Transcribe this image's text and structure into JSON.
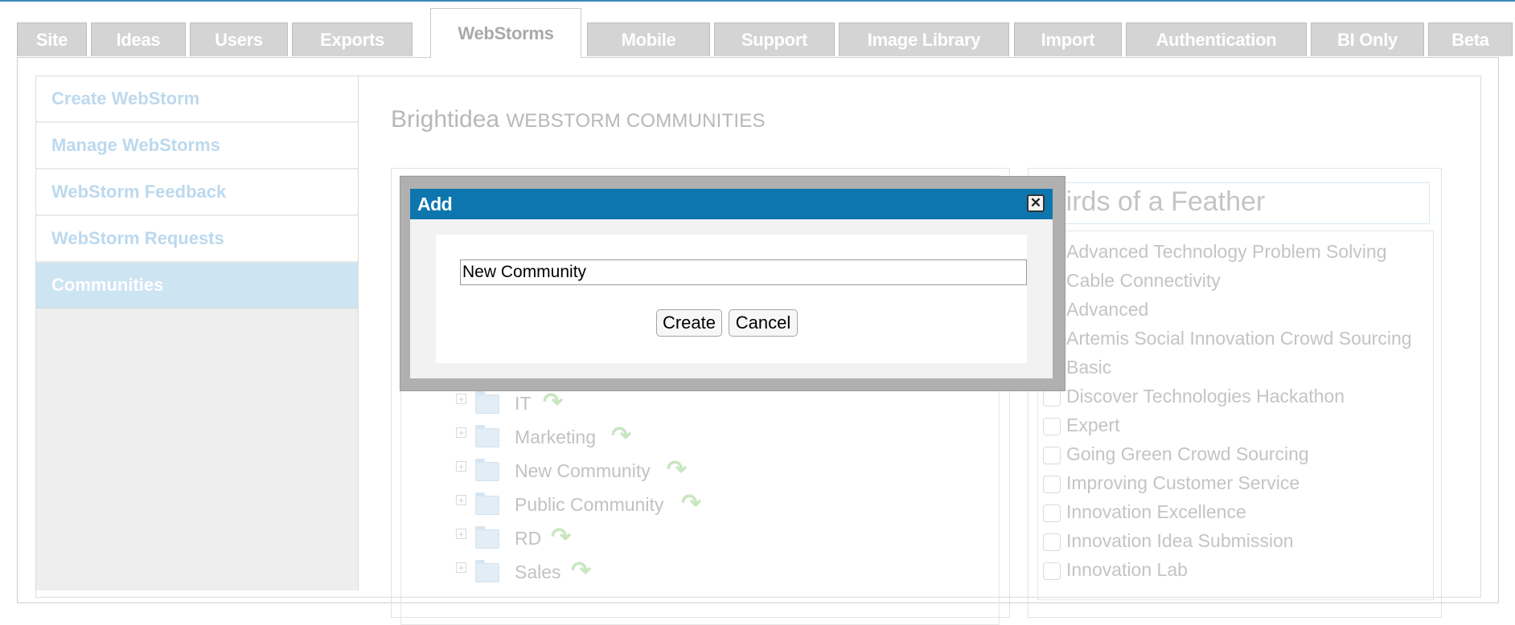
{
  "tabs": [
    {
      "label": "Site"
    },
    {
      "label": "Ideas"
    },
    {
      "label": "Users"
    },
    {
      "label": "Exports"
    },
    {
      "label": "WebStorms",
      "active": true
    },
    {
      "label": "Mobile"
    },
    {
      "label": "Support"
    },
    {
      "label": "Image Library"
    },
    {
      "label": "Import"
    },
    {
      "label": "Authentication"
    },
    {
      "label": "BI Only"
    },
    {
      "label": "Beta"
    }
  ],
  "sidebar": {
    "items": [
      {
        "label": "Create WebStorm"
      },
      {
        "label": "Manage WebStorms"
      },
      {
        "label": "WebStorm Feedback"
      },
      {
        "label": "WebStorm Requests"
      },
      {
        "label": "Communities",
        "active": true
      }
    ]
  },
  "main": {
    "heading_brand": "Brightidea",
    "heading_sub": "WEBSTORM COMMUNITIES",
    "tree": [
      {
        "name": "IT"
      },
      {
        "name": "Marketing"
      },
      {
        "name": "New Community"
      },
      {
        "name": "Public Community"
      },
      {
        "name": "RD"
      },
      {
        "name": "Sales"
      }
    ]
  },
  "right_panel": {
    "title": "Birds of a Feather",
    "items": [
      {
        "label": "Advanced Technology Problem Solving",
        "checked": true
      },
      {
        "label": "Cable Connectivity",
        "checked": true
      },
      {
        "label": "Advanced",
        "checked": false
      },
      {
        "label": "Artemis Social Innovation Crowd Sourcing",
        "checked": false
      },
      {
        "label": "Basic",
        "checked": false
      },
      {
        "label": "Discover Technologies Hackathon",
        "checked": false
      },
      {
        "label": "Expert",
        "checked": false
      },
      {
        "label": "Going Green Crowd Sourcing",
        "checked": false
      },
      {
        "label": "Improving Customer Service",
        "checked": false
      },
      {
        "label": "Innovation Excellence",
        "checked": false
      },
      {
        "label": "Innovation Idea Submission",
        "checked": false
      },
      {
        "label": "Innovation Lab",
        "checked": false
      }
    ]
  },
  "modal": {
    "title": "Add",
    "input_value": "New Community",
    "create_label": "Create",
    "cancel_label": "Cancel",
    "close_glyph": "✕"
  }
}
